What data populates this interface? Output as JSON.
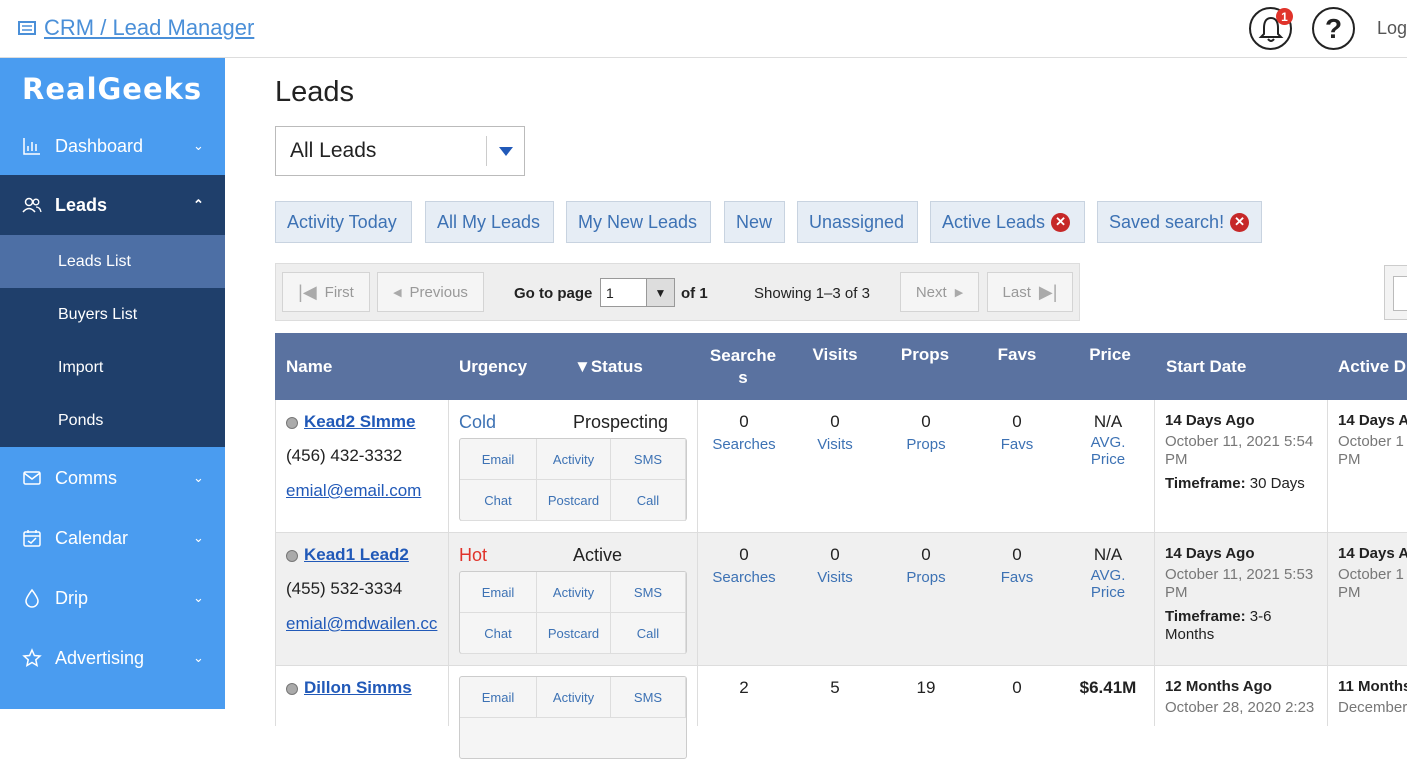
{
  "topbar": {
    "breadcrumb": "CRM / Lead Manager",
    "notif_count": "1",
    "logout_partial": "Log"
  },
  "sidebar": {
    "logo": "RealGeeks",
    "items": [
      {
        "label": "Dashboard",
        "icon": "bar-chart-icon"
      },
      {
        "label": "Leads",
        "icon": "users-icon"
      },
      {
        "label": "Comms",
        "icon": "envelope-icon"
      },
      {
        "label": "Calendar",
        "icon": "calendar-icon"
      },
      {
        "label": "Drip",
        "icon": "droplet-icon"
      },
      {
        "label": "Advertising",
        "icon": "star-icon"
      }
    ],
    "subitems": [
      "Leads List",
      "Buyers List",
      "Import",
      "Ponds"
    ]
  },
  "main": {
    "title": "Leads",
    "filter_select": "All Leads",
    "filters": [
      "Activity Today",
      "All My Leads",
      "My New Leads",
      "New",
      "Unassigned",
      "Active Leads",
      "Saved search!"
    ],
    "pager": {
      "first": "First",
      "previous": "Previous",
      "goto": "Go to page",
      "page": "1",
      "of": "of 1",
      "showing": "Showing 1–3 of 3",
      "next": "Next",
      "last": "Last"
    }
  },
  "table": {
    "headers": [
      "Name",
      "Urgency",
      "▼Status",
      "Searche\ns",
      "Visits",
      "Props",
      "Favs",
      "Price",
      "Start Date",
      "Active D"
    ],
    "actions": [
      "Email",
      "Activity",
      "SMS",
      "Chat",
      "Postcard",
      "Call"
    ],
    "rows": [
      {
        "name": "Kead2 SImme",
        "phone": "(456) 432-3332",
        "email": "emial@email.com",
        "urgency": "Cold",
        "status": "Prospecting",
        "searches": "0",
        "visits": "0",
        "props": "0",
        "favs": "0",
        "price": "N/A",
        "searches_l": "Searches",
        "visits_l": "Visits",
        "props_l": "Props",
        "favs_l": "Favs",
        "price_l": "AVG. Price",
        "start_rel": "14 Days Ago",
        "start_abs": "October 11, 2021 5:54 PM",
        "timeframe_label": "Timeframe:",
        "timeframe": " 30 Days",
        "active_rel": "14 Days A",
        "active_abs": "October 1 PM"
      },
      {
        "name": "Kead1 Lead2",
        "phone": "(455) 532-3334",
        "email": "emial@mdwailen.cc",
        "urgency": "Hot",
        "status": "Active",
        "searches": "0",
        "visits": "0",
        "props": "0",
        "favs": "0",
        "price": "N/A",
        "searches_l": "Searches",
        "visits_l": "Visits",
        "props_l": "Props",
        "favs_l": "Favs",
        "price_l": "AVG. Price",
        "start_rel": "14 Days Ago",
        "start_abs": "October 11, 2021 5:53 PM",
        "timeframe_label": "Timeframe:",
        "timeframe": " 3-6 Months",
        "active_rel": "14 Days A",
        "active_abs": "October 1 PM"
      },
      {
        "name": "Dillon Simms",
        "searches": "2",
        "visits": "5",
        "props": "19",
        "favs": "0",
        "price": "$6.41M",
        "start_rel": "12 Months Ago",
        "start_abs": "October 28, 2020 2:23",
        "active_rel": "11 Months",
        "active_abs": "December"
      }
    ]
  },
  "colors": {
    "sidebar": "#4a9cf0",
    "sidebar_active": "#1f3f6b",
    "header": "#5a72a0",
    "cold": "#3d72b4",
    "hot": "#e0332a"
  }
}
